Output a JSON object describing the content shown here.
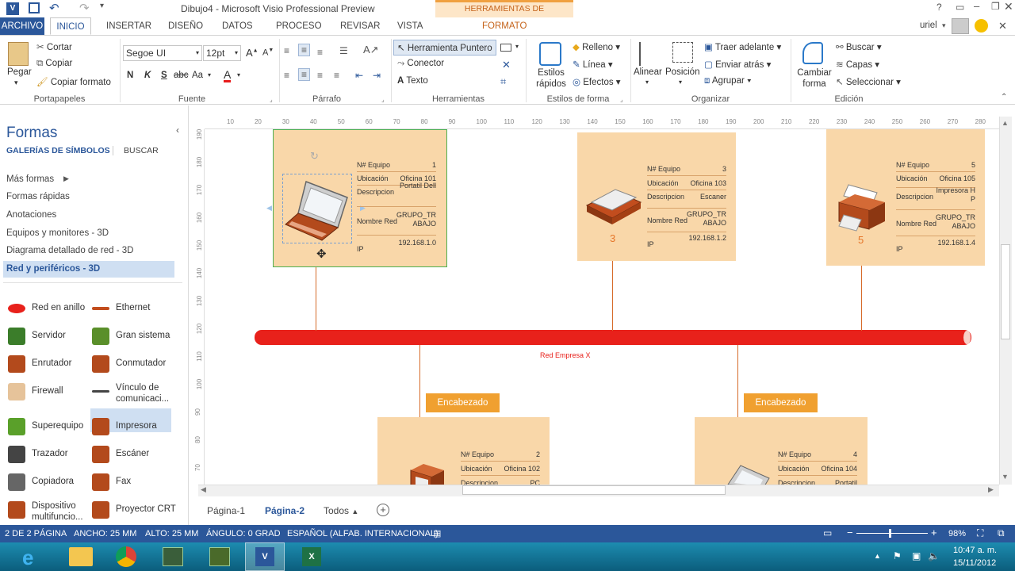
{
  "window": {
    "title": "Dibujo4 - Microsoft Visio Professional Preview",
    "contextual_tab_group": "HERRAMIENTAS DE CONTENEDOR",
    "user": "uriel",
    "help": "?"
  },
  "tabs": [
    "ARCHIVO",
    "INICIO",
    "INSERTAR",
    "DISEÑO",
    "DATOS",
    "PROCESO",
    "REVISAR",
    "VISTA",
    "FORMATO"
  ],
  "ribbon": {
    "clipboard": {
      "paste": "Pegar",
      "cut": "Cortar",
      "copy": "Copiar",
      "format_painter": "Copiar formato",
      "label": "Portapapeles"
    },
    "font": {
      "family": "Segoe UI",
      "size": "12pt",
      "bold": "N",
      "italic": "K",
      "underline": "S",
      "strike": "abc",
      "case": "Aa",
      "color": "A",
      "label": "Fuente"
    },
    "paragraph": {
      "label": "Párrafo"
    },
    "tools": {
      "pointer": "Herramienta Puntero",
      "connector": "Conector",
      "text": "Texto",
      "label": "Herramientas"
    },
    "shape_styles": {
      "quick_styles": "Estilos rápidos",
      "fill": "Relleno",
      "line": "Línea",
      "effects": "Efectos",
      "label": "Estilos de forma"
    },
    "arrange": {
      "align": "Alinear",
      "position": "Posición",
      "bring_forward": "Traer adelante",
      "send_backward": "Enviar atrás",
      "group": "Agrupar",
      "label": "Organizar"
    },
    "editing": {
      "change_shape": "Cambiar forma",
      "find": "Buscar",
      "layers": "Capas",
      "select": "Seleccionar",
      "label": "Edición"
    }
  },
  "shapes_pane": {
    "title": "Formas",
    "tab_stencils": "GALERÍAS DE SÍMBOLOS",
    "tab_search": "BUSCAR",
    "links": [
      "Más formas",
      "Formas rápidas",
      "Anotaciones",
      "Equipos y monitores - 3D",
      "Diagrama detallado de red - 3D",
      "Red y periféricos - 3D"
    ],
    "items": [
      [
        "Red en anillo",
        "Ethernet"
      ],
      [
        "Servidor",
        "Gran sistema"
      ],
      [
        "Enrutador",
        "Conmutador"
      ],
      [
        "Firewall",
        "Vínculo de comunicaci..."
      ],
      [
        "Superequipo",
        "Impresora"
      ],
      [
        "Trazador",
        "Escáner"
      ],
      [
        "Copiadora",
        "Fax"
      ],
      [
        "Dispositivo multifuncio...",
        "Proyector CRT"
      ]
    ]
  },
  "ruler": {
    "h": [
      "10",
      "20",
      "30",
      "40",
      "50",
      "60",
      "70",
      "80",
      "90",
      "100",
      "110",
      "120",
      "130",
      "140",
      "150",
      "160",
      "170",
      "180",
      "190",
      "200",
      "210",
      "220",
      "230",
      "240",
      "250",
      "260",
      "270",
      "280"
    ],
    "v": [
      "190",
      "180",
      "170",
      "160",
      "150",
      "140",
      "130",
      "120",
      "110",
      "100",
      "90",
      "80",
      "70"
    ]
  },
  "diagram": {
    "network_label": "Red Empresa X",
    "header_text": "Encabezado",
    "cards": [
      {
        "id": "1",
        "rows": [
          [
            "N# Equipo",
            "1"
          ],
          [
            "Ubicación",
            "Oficina 101"
          ],
          [
            "Descripcion",
            "Portatil Dell"
          ],
          [
            "Nombre Red",
            "GRUPO_TRABAJO"
          ],
          [
            "IP",
            "192.168.1.0"
          ]
        ]
      },
      {
        "id": "3",
        "rows": [
          [
            "N# Equipo",
            "3"
          ],
          [
            "Ubicación",
            "Oficina 103"
          ],
          [
            "Descripcion",
            "Escaner"
          ],
          [
            "Nombre Red",
            "GRUPO_TRABAJO"
          ],
          [
            "IP",
            "192.168.1.2"
          ]
        ]
      },
      {
        "id": "5",
        "rows": [
          [
            "N# Equipo",
            "5"
          ],
          [
            "Ubicación",
            "Oficina 105"
          ],
          [
            "Descripcion",
            "Impresora HP"
          ],
          [
            "Nombre Red",
            "GRUPO_TRABAJO"
          ],
          [
            "IP",
            "192.168.1.4"
          ]
        ]
      },
      {
        "id": "2",
        "rows": [
          [
            "N# Equipo",
            "2"
          ],
          [
            "Ubicación",
            "Oficina 102"
          ],
          [
            "Descripcion",
            "PC"
          ]
        ]
      },
      {
        "id": "4",
        "rows": [
          [
            "N# Equipo",
            "4"
          ],
          [
            "Ubicación",
            "Oficina 104"
          ],
          [
            "Descripcion",
            "Portatil"
          ]
        ]
      }
    ]
  },
  "page_tabs": [
    "Página-1",
    "Página-2",
    "Todos"
  ],
  "status": {
    "page": "2 DE 2 PÁGINA",
    "width": "ANCHO: 25 MM",
    "height": "ALTO: 25 MM",
    "angle": "ÁNGULO: 0 GRAD",
    "language": "ESPAÑOL (ALFAB. INTERNACIONAL)",
    "zoom": "98%"
  },
  "taskbar": {
    "time": "10:47 a. m.",
    "date": "15/11/2012"
  },
  "colors": {
    "accent": "#2b579a",
    "card": "#f9d7a9",
    "network": "#e8211b",
    "header": "#f0a030"
  }
}
